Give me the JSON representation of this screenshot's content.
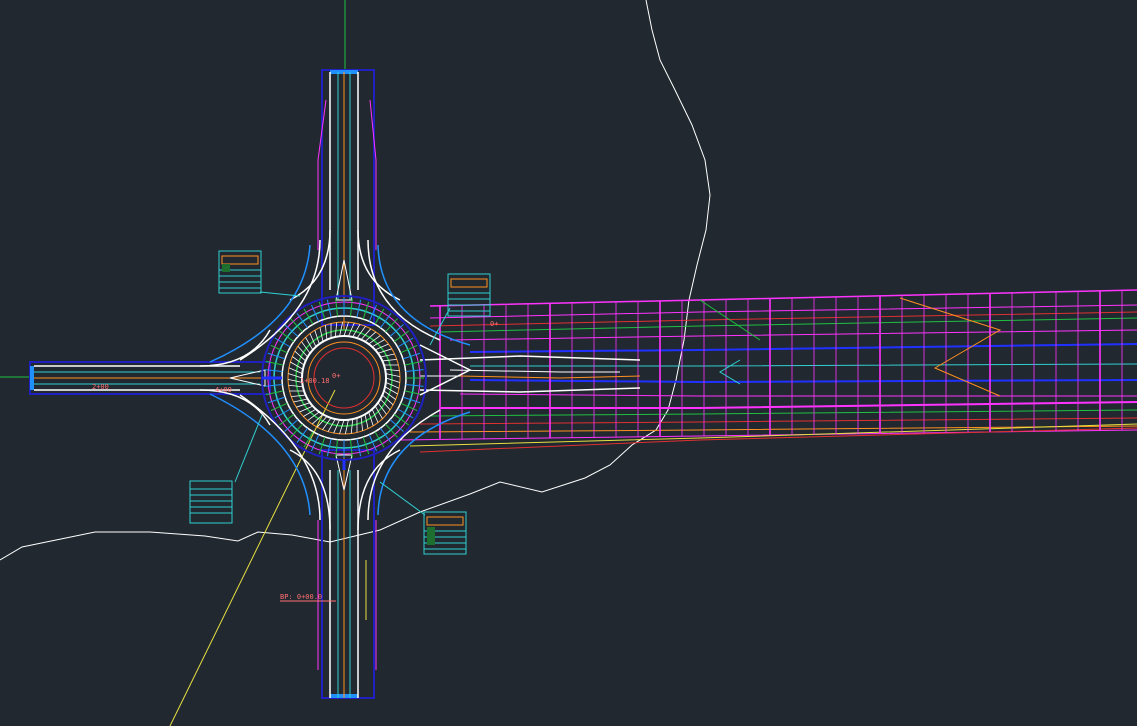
{
  "app": {
    "view": "Model space"
  },
  "colors": {
    "background": "#212830",
    "white": "#ffffff",
    "magenta": "#ff33ff",
    "blue": "#2030ff",
    "navy": "#2020c0",
    "cyan": "#30d0d0",
    "green": "#20c040",
    "orange": "#ff9020",
    "red": "#e03030",
    "yellow": "#e8e040",
    "salmon": "#ff7070"
  },
  "labels": {
    "bp_station": "BP: 0+00.0",
    "west_station": "2+00",
    "west_station_2": "4+00",
    "center_station": "1+00.18",
    "center_short": "0+",
    "east_label": "0+"
  },
  "title_blocks": [
    {
      "name": "callout-nw"
    },
    {
      "name": "callout-ne"
    },
    {
      "name": "callout-sw"
    },
    {
      "name": "callout-se"
    }
  ]
}
